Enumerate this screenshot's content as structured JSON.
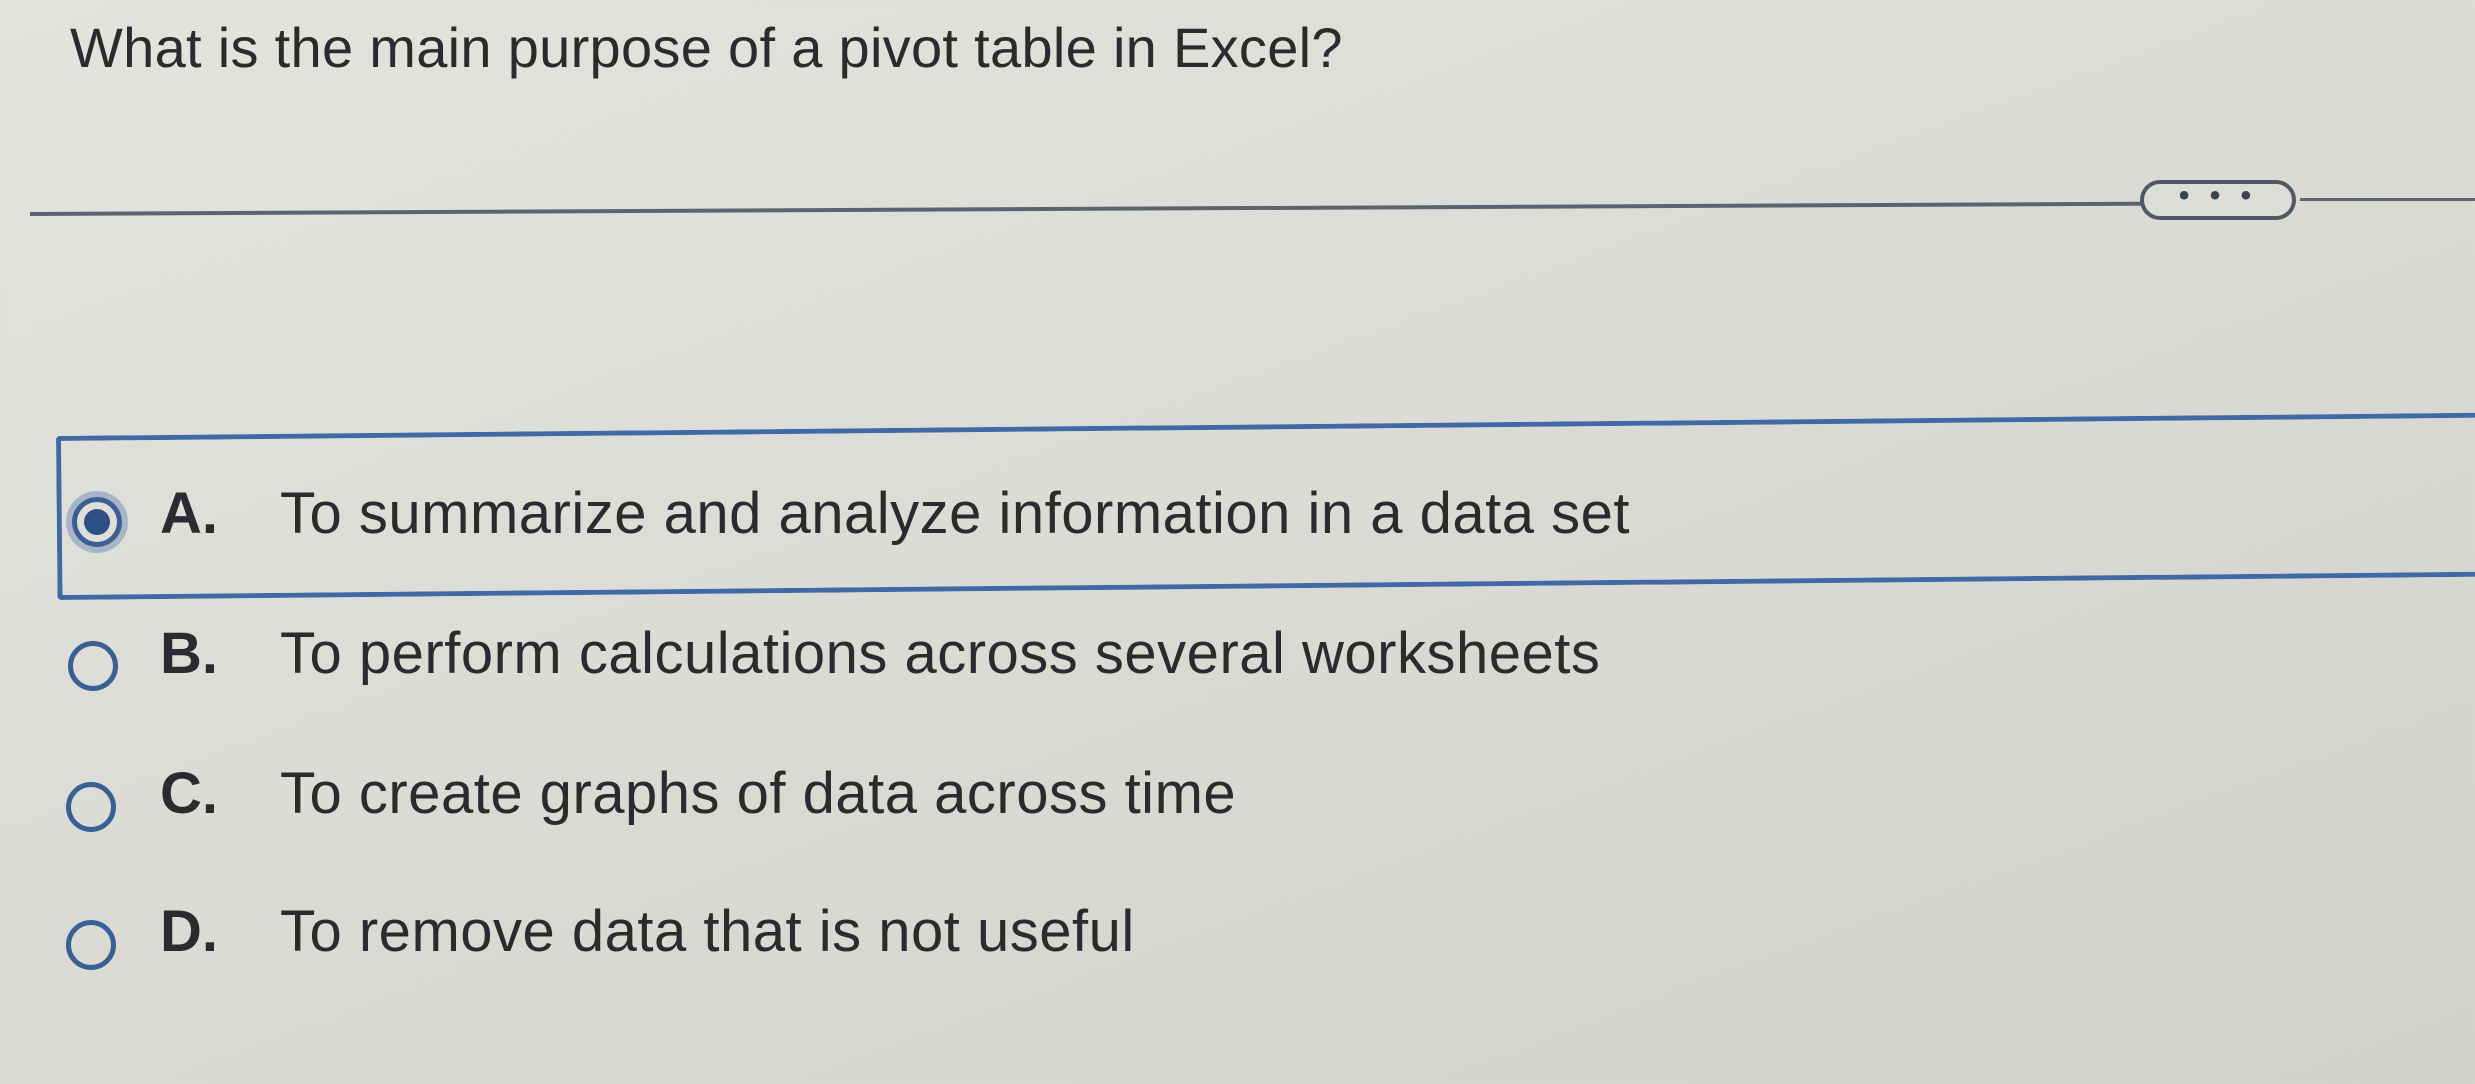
{
  "question": {
    "text": "What is the main purpose of a pivot table in Excel?"
  },
  "more_button": {
    "label": "• • •"
  },
  "options": [
    {
      "letter": "A.",
      "text": "To summarize and analyze information in a data set",
      "selected": true
    },
    {
      "letter": "B.",
      "text": "To perform calculations across several worksheets",
      "selected": false
    },
    {
      "letter": "C.",
      "text": "To create graphs of data across time",
      "selected": false
    },
    {
      "letter": "D.",
      "text": "To remove data that is not useful",
      "selected": false
    }
  ],
  "colors": {
    "accent": "#3f6aa3",
    "radio": "#3a5f93",
    "text": "#2a2b2f",
    "background": "#dcdbd6"
  }
}
